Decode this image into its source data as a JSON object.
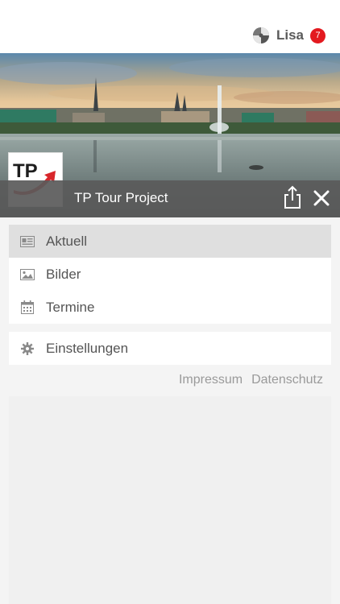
{
  "header": {
    "user_name": "Lisa",
    "notification_count": "7",
    "app_logo_icon": "pinwheel-logo-icon",
    "badge_color": "#e3191f"
  },
  "hero": {
    "title": "TP Tour Project",
    "logo_text": "TP",
    "share_icon": "share-icon",
    "close_icon": "close-icon"
  },
  "menu": {
    "items": [
      {
        "label": "Aktuell",
        "icon": "newspaper-icon",
        "active": true
      },
      {
        "label": "Bilder",
        "icon": "image-icon",
        "active": false
      },
      {
        "label": "Termine",
        "icon": "calendar-icon",
        "active": false
      }
    ],
    "settings": {
      "label": "Einstellungen",
      "icon": "gear-icon"
    }
  },
  "footer_links": {
    "impressum": "Impressum",
    "datenschutz": "Datenschutz"
  }
}
